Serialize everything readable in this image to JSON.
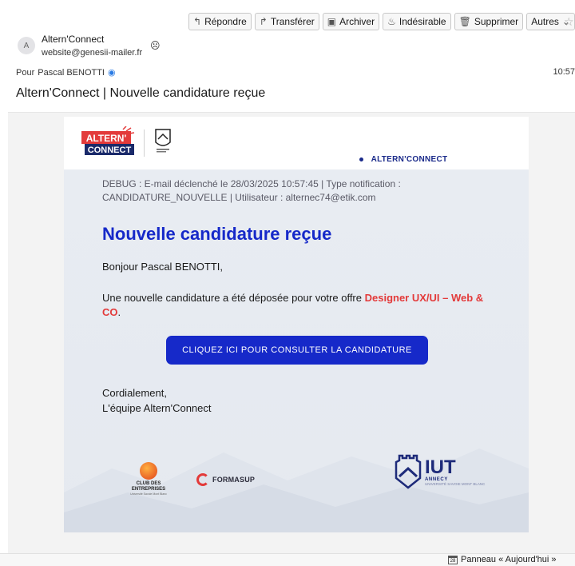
{
  "toolbar": {
    "reply": {
      "label": "Répondre",
      "icon": "reply-icon"
    },
    "forward": {
      "label": "Transférer",
      "icon": "forward-icon"
    },
    "archive": {
      "label": "Archiver",
      "icon": "archive-icon"
    },
    "junk": {
      "label": "Indésirable",
      "icon": "junk-icon"
    },
    "delete": {
      "label": "Supprimer",
      "icon": "trash-icon"
    },
    "more": {
      "label": "Autres",
      "icon": "chevron-down-icon"
    }
  },
  "message": {
    "avatar_letter": "A",
    "from_name": "Altern'Connect",
    "from_address": "website@genesii-mailer.fr",
    "to_prefix": "Pour",
    "to_name": "Pascal BENOTTI",
    "time": "10:57",
    "subject": "Altern'Connect | Nouvelle candidature reçue"
  },
  "email": {
    "logo_line1": "ALTERN'",
    "logo_line2": "CONNECT",
    "brand_pill": "ALTERN'CONNECT",
    "debug_text": "DEBUG : E-mail déclenché le 28/03/2025 10:57:45 | Type notification : CANDIDATURE_NOUVELLE | Utilisateur : alternec74@etik.com",
    "headline": "Nouvelle candidature reçue",
    "greeting": "Bonjour Pascal BENOTTI,",
    "para_before": "Une nouvelle candidature a été déposée pour votre offre ",
    "offer": "Designer UX/UI – Web & CO",
    "para_after": ".",
    "cta_label": "CLIQUEZ ICI POUR CONSULTER LA CANDIDATURE",
    "closing_line1": "Cordialement,",
    "closing_line2": "L'équipe Altern'Connect",
    "partners": {
      "club_line1": "CLUB DES",
      "club_line2": "ENTREPRISES",
      "club_line3": "Université Savoie Mont Blanc",
      "forma": "FORMASUP",
      "iut_big": "IUT",
      "iut_sub": "ANNECY",
      "iut_sub2": "UNIVERSITÉ SAVOIE MONT BLANC"
    }
  },
  "statusbar": {
    "today_panel": "Panneau « Aujourd'hui »",
    "cal_day": "28"
  },
  "colors": {
    "accent_blue": "#1629c9",
    "offer_red": "#e33a3a",
    "logo_red": "#e33a3a",
    "logo_navy": "#1a2a6a"
  }
}
